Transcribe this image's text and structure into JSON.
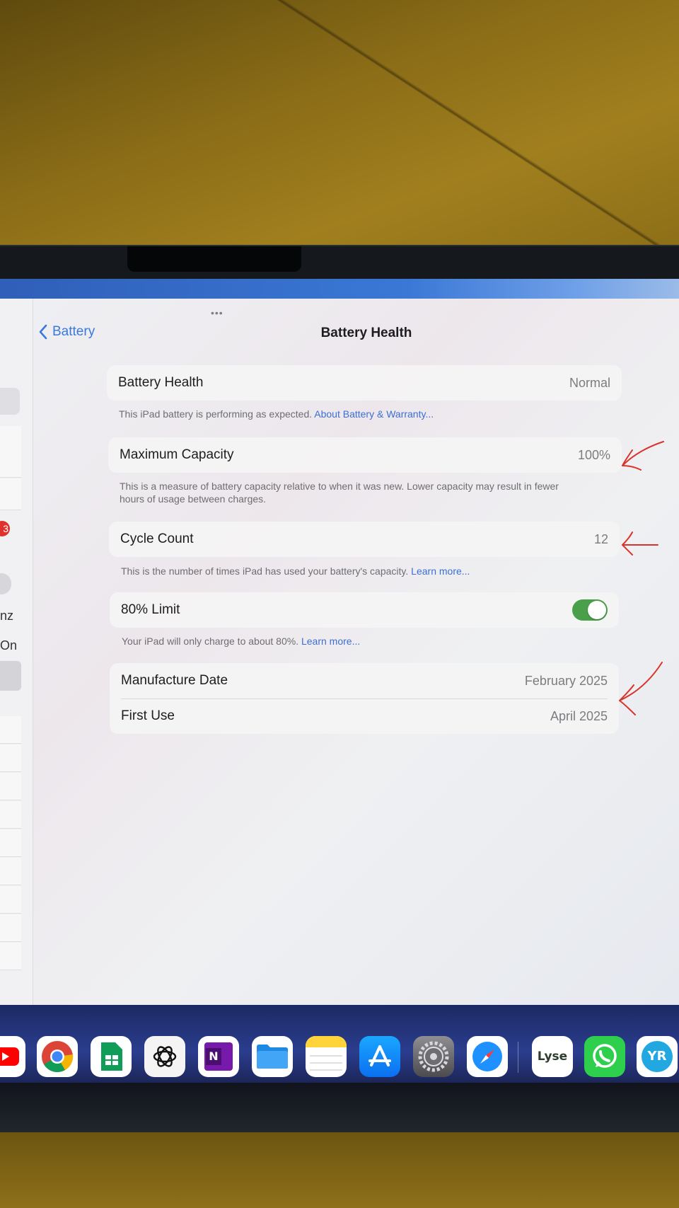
{
  "nav": {
    "back_label": "Battery",
    "title": "Battery Health",
    "multitask_dots": "•••"
  },
  "battery_health": {
    "label": "Battery Health",
    "value": "Normal",
    "footer_text": "This iPad battery is performing as expected.",
    "footer_link": "About Battery & Warranty..."
  },
  "maximum_capacity": {
    "label": "Maximum Capacity",
    "value": "100%",
    "footer_line1": "This is a measure of battery capacity relative to when it was new. Lower capacity may result in fewer",
    "footer_line2": "hours of usage between charges."
  },
  "cycle_count": {
    "label": "Cycle Count",
    "value": "12",
    "footer_text": "This is the number of times iPad has used your battery's capacity.",
    "footer_link": "Learn more..."
  },
  "limit_80": {
    "label": "80% Limit",
    "enabled": true,
    "footer_text": "Your iPad will only charge to about 80%.",
    "footer_link": "Learn more..."
  },
  "dates": {
    "manufacture_label": "Manufacture Date",
    "manufacture_value": "February 2025",
    "first_use_label": "First Use",
    "first_use_value": "April 2025"
  },
  "sidebar_fragments": {
    "badge": "3",
    "frag_hz": "nz",
    "frag_on": "On"
  },
  "dock": {
    "apps": [
      "youtube",
      "chrome",
      "google-sheets",
      "chatgpt",
      "onenote",
      "files",
      "notes",
      "app-store",
      "settings",
      "safari",
      "lyse",
      "whatsapp",
      "yr"
    ],
    "lyse_label": "Lyse",
    "onenote_label": "N",
    "yr_label": "YR"
  },
  "colors": {
    "accent_link": "#3b6fd1",
    "toggle_on": "#4aa04a",
    "annotation_red": "#d9342b",
    "badge_red": "#e0312d"
  }
}
